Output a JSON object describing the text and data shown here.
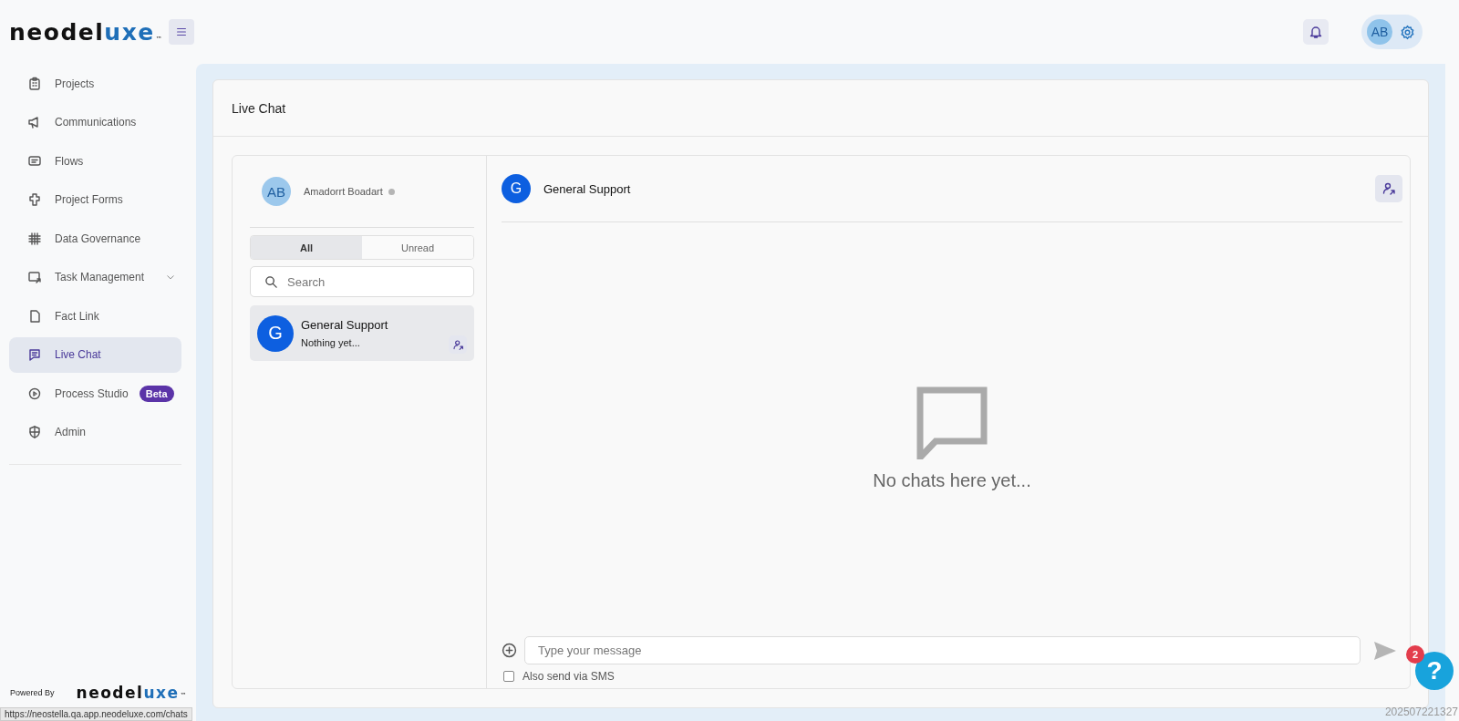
{
  "header": {
    "logo": {
      "dark": "neodel",
      "accent": "uxe",
      "tm": "™"
    },
    "avatar": "AB"
  },
  "sidebar": {
    "items": [
      {
        "label": "Projects",
        "selected": false
      },
      {
        "label": "Communications",
        "selected": false
      },
      {
        "label": "Flows",
        "selected": false
      },
      {
        "label": "Project Forms",
        "selected": false
      },
      {
        "label": "Data Governance",
        "selected": false
      },
      {
        "label": "Task Management",
        "selected": false,
        "expanded": false
      },
      {
        "label": "Fact Link",
        "selected": false
      },
      {
        "label": "Live Chat",
        "selected": true
      },
      {
        "label": "Process Studio",
        "selected": false,
        "badge": "Beta"
      },
      {
        "label": "Admin",
        "selected": false
      }
    ],
    "powered_by": "Powered By",
    "footer_logo": {
      "dark": "neodel",
      "accent": "uxe",
      "tm": "™"
    }
  },
  "status_url": "https://neostella.qa.app.neodeluxe.com/chats",
  "page": {
    "title": "Live Chat",
    "agent": {
      "avatar": "AB",
      "name": "Amadorrt Boadart",
      "online": false
    },
    "tabs": [
      {
        "label": "All",
        "selected": true
      },
      {
        "label": "Unread",
        "selected": false
      }
    ],
    "search": {
      "placeholder": "Search"
    },
    "chats": [
      {
        "avatar": "G",
        "name": "General Support",
        "preview": "Nothing yet...",
        "selected": true
      }
    ],
    "conversation": {
      "avatar": "G",
      "name": "General Support",
      "empty_text": "No chats here yet...",
      "input": {
        "placeholder": "Type your message"
      },
      "sms": {
        "label": "Also send via SMS",
        "checked": false
      }
    }
  },
  "help": {
    "symbol": "?",
    "count": "2"
  },
  "build": "202507221327"
}
